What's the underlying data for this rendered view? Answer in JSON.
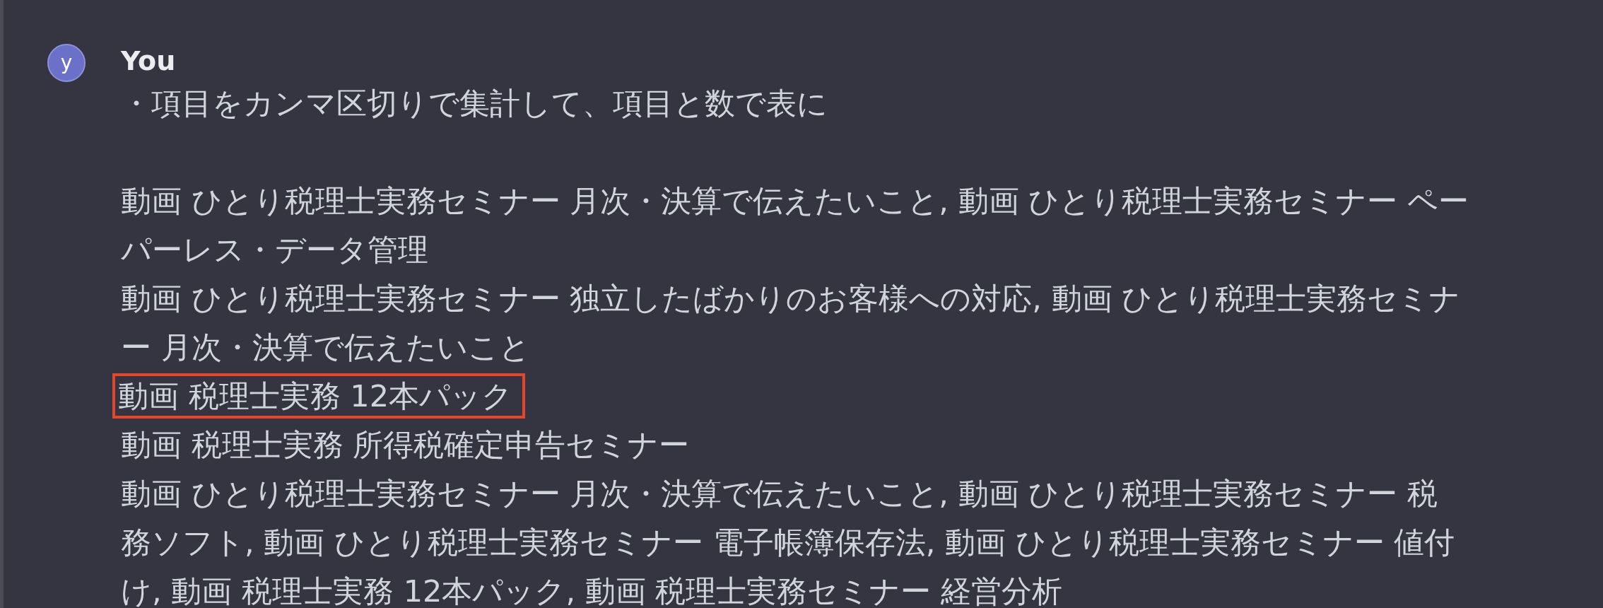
{
  "message": {
    "avatar": "y",
    "author": "You",
    "instruction": "・項目をカンマ区切りで集計して、項目と数で表に",
    "lines": [
      {
        "text": "動画 ひとり税理士実務セミナー 月次・決算で伝えたいこと, 動画 ひとり税理士実務セミナー ペー"
      },
      {
        "text": "パーレス・データ管理"
      },
      {
        "text": "動画 ひとり税理士実務セミナー 独立したばかりのお客様への対応, 動画 ひとり税理士実務セミナ"
      },
      {
        "text": "ー 月次・決算で伝えたいこと"
      },
      {
        "text": "動画 税理士実務 12本パック",
        "highlighted": true
      },
      {
        "text": "動画 税理士実務 所得税確定申告セミナー"
      },
      {
        "text": "動画 ひとり税理士実務セミナー 月次・決算で伝えたいこと, 動画 ひとり税理士実務セミナー 税"
      },
      {
        "text": "務ソフト, 動画 ひとり税理士実務セミナー 電子帳簿保存法, 動画 ひとり税理士実務セミナー 値付"
      },
      {
        "text": "け, 動画 税理士実務 12本パック, 動画 税理士実務セミナー 経営分析"
      }
    ]
  }
}
